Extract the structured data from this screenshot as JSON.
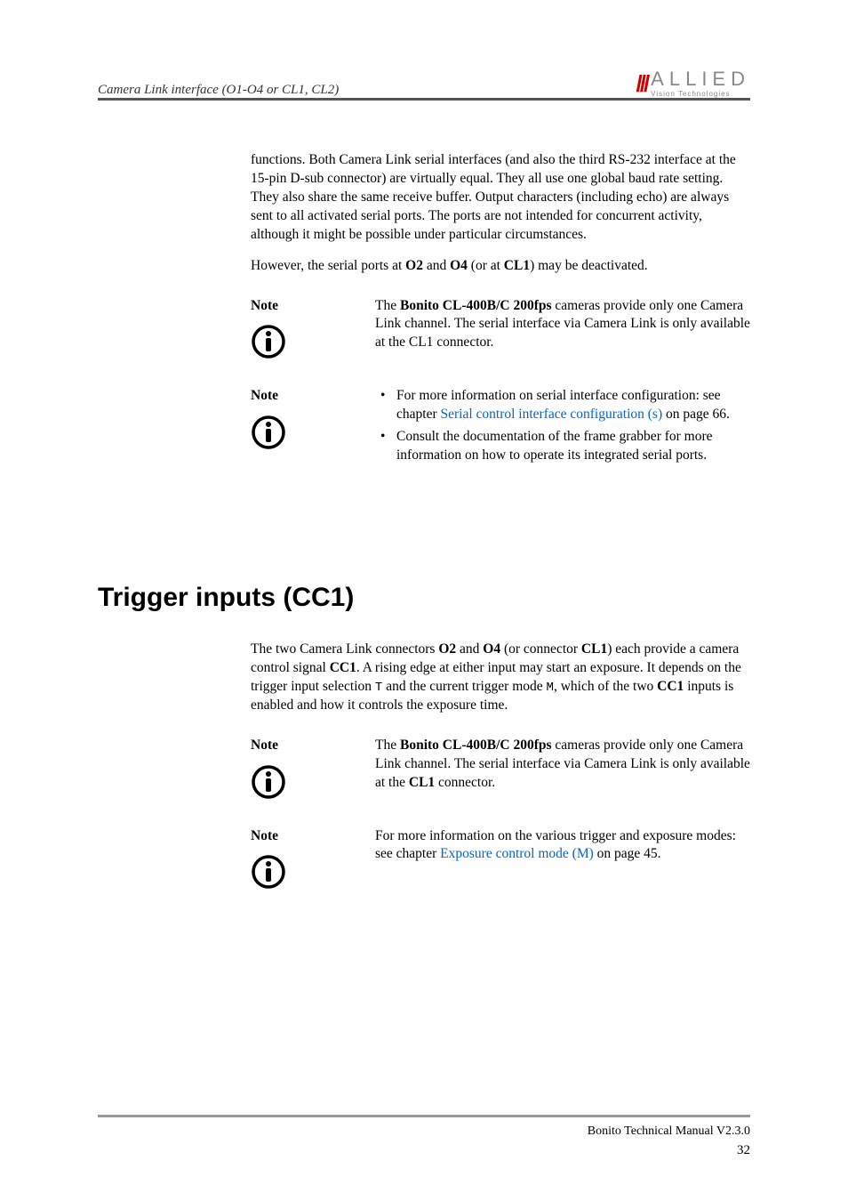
{
  "header": {
    "title": "Camera Link interface (O1-O4 or CL1, CL2)",
    "logo_main": "ALLIED",
    "logo_sub": "Vision Technologies"
  },
  "content": {
    "para1": "functions. Both Camera Link serial interfaces (and also the third RS-232 interface at the 15-pin D-sub connector) are virtually equal. They all use one global baud rate setting. They also share the same receive buffer. Output characters (including echo) are always sent to all activated serial ports. The ports are not intended for concurrent activity, although it might be possible under particular circumstances.",
    "para2_pre": "However, the serial ports at ",
    "para2_b1": "O2",
    "para2_mid1": " and ",
    "para2_b2": "O4",
    "para2_mid2": " (or at ",
    "para2_b3": "CL1",
    "para2_end": ") may be deactivated.",
    "note_label": "Note",
    "note1_pre": "The ",
    "note1_bold": "Bonito CL-400B/C 200fps",
    "note1_rest": " cameras provide only one Camera Link channel. The serial interface via Camera Link is only available at the CL1 connector.",
    "note2_li1_pre": "For more information on serial interface configuration: see chapter ",
    "note2_li1_link": "Serial control interface configuration (s)",
    "note2_li1_post": " on page 66.",
    "note2_li2": "Consult the documentation of the frame grabber for more information on how to operate its integrated serial ports."
  },
  "heading2": "Trigger inputs (CC1)",
  "section2": {
    "p1_a": "The two Camera Link connectors ",
    "p1_b1": "O2",
    "p1_b": " and ",
    "p1_b2": "O4",
    "p1_c": " (or connector ",
    "p1_b3": "CL1",
    "p1_d": ") each provide a camera control signal ",
    "p1_b4": "CC1",
    "p1_e": ". A rising edge at either input may start an exposure. It depends on the trigger input selection ",
    "p1_m1": "T",
    "p1_f": " and the current trigger mode ",
    "p1_m2": "M",
    "p1_g": ", which of the two ",
    "p1_b5": "CC1",
    "p1_h": " inputs is enabled and how it controls the exposure time.",
    "note3_pre": "The ",
    "note3_bold": "Bonito CL-400B/C 200fps",
    "note3_rest1": " cameras provide only one Camera Link channel. The serial interface via Camera Link is only available at the ",
    "note3_bold2": "CL1",
    "note3_rest2": " connector.",
    "note4_pre": "For more information on the various trigger and exposure modes: see chapter ",
    "note4_link": "Exposure control mode (M)",
    "note4_post": " on page 45."
  },
  "footer": {
    "text": "Bonito Technical Manual V2.3.0",
    "page": "32"
  }
}
